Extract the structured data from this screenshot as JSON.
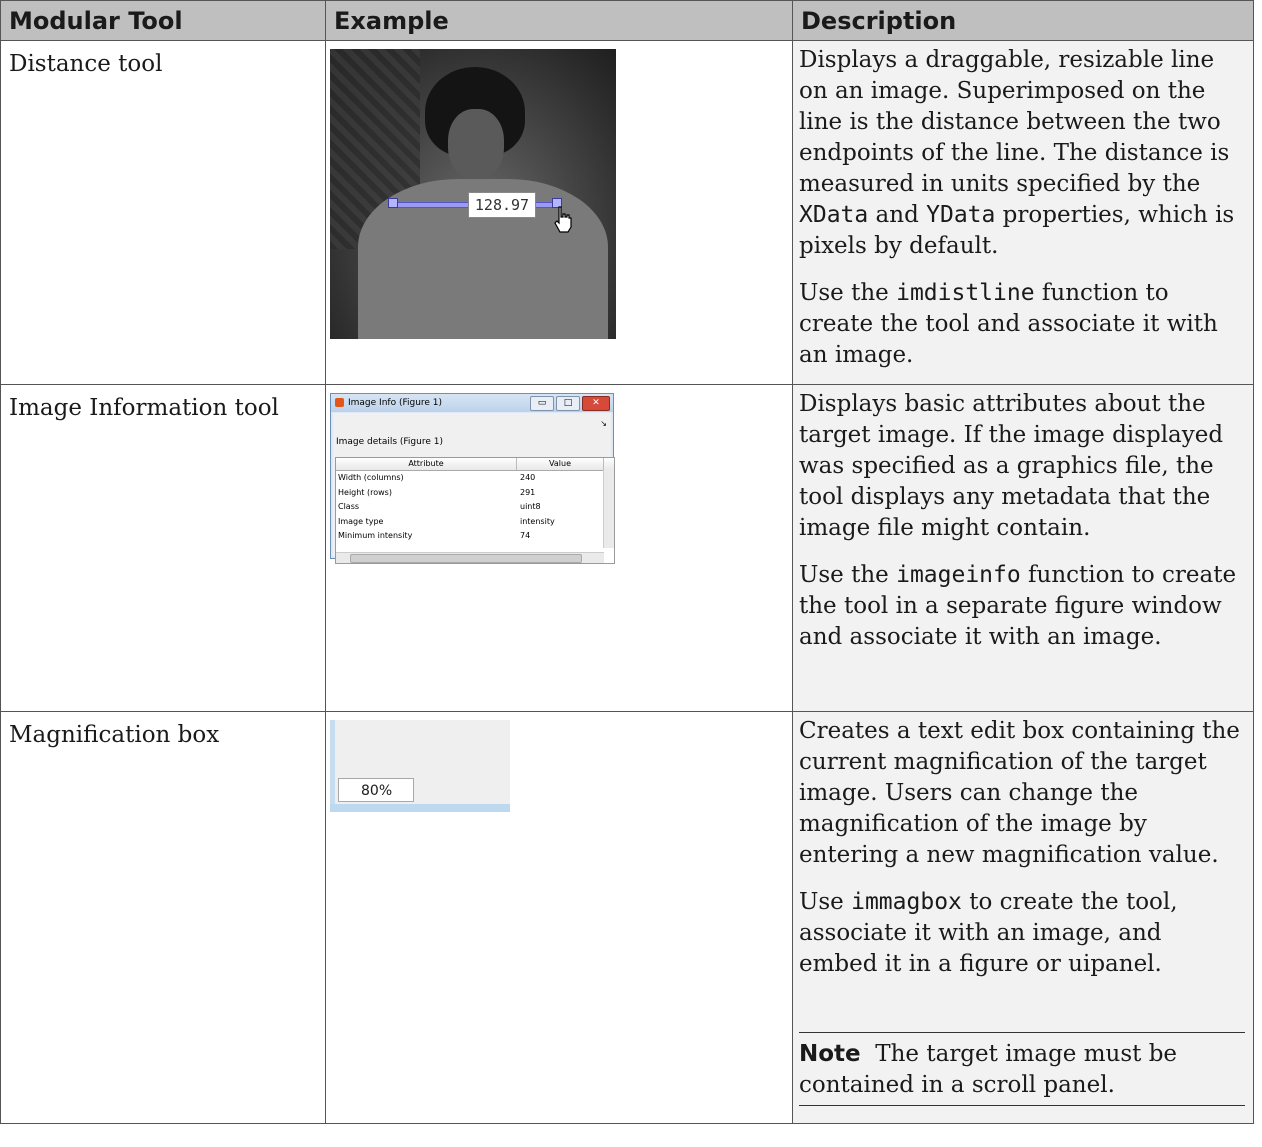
{
  "headers": [
    "Modular Tool",
    "Example",
    "Description"
  ],
  "rows": [
    {
      "tool": "Distance tool",
      "example": {
        "label": "128.97"
      },
      "desc1": [
        "Displays a draggable, resizable line on an image. Superimposed on the line is the distance between the two endpoints of the line. The distance is measured in units specified by the ",
        "XData",
        " and ",
        "YData",
        " properties, which is pixels by default."
      ],
      "desc2": [
        "Use the ",
        "imdistline",
        " function to create the tool and associate it with an image."
      ]
    },
    {
      "tool": "Image Information tool",
      "example": {
        "window_title": "Image Info (Figure 1)",
        "details_label": "Image details  (Figure 1)",
        "columns": [
          "Attribute",
          "Value"
        ],
        "rows": [
          [
            "Width (columns)",
            "240"
          ],
          [
            "Height (rows)",
            "291"
          ],
          [
            "Class",
            "uint8"
          ],
          [
            "Image type",
            "intensity"
          ],
          [
            "Minimum intensity",
            "74"
          ]
        ]
      },
      "desc1": [
        "Displays basic attributes about the target image. If the image displayed was specified as a graphics file, the tool displays any metadata that the image file might contain."
      ],
      "desc2": [
        "Use the ",
        "imageinfo",
        " function to create the tool in a separate figure window and associate it with an image."
      ]
    },
    {
      "tool": "Magnification box",
      "example": {
        "value": "80%"
      },
      "desc1": [
        "Creates a text edit box containing the current magnification of the target image. Users can change the magnification of the image by entering a new magnification value."
      ],
      "desc2": [
        "Use ",
        "immagbox",
        " to create the tool, associate it with an image, and embed it in a figure or uipanel."
      ],
      "note_label": "Note",
      "note_text": "The target image must be contained in a scroll panel."
    }
  ]
}
